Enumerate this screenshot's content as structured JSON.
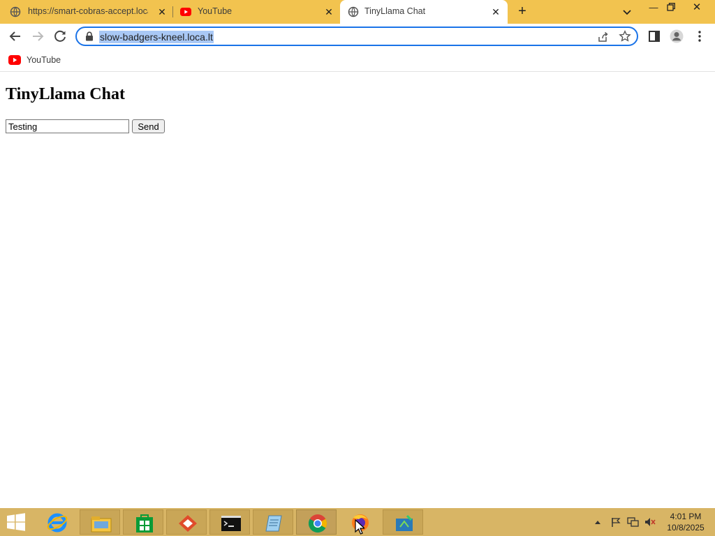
{
  "browser": {
    "tabs": [
      {
        "title": "https://smart-cobras-accept.loca.lt",
        "favicon": "globe-icon",
        "active": false
      },
      {
        "title": "YouTube",
        "favicon": "youtube-icon",
        "active": false
      },
      {
        "title": "TinyLlama Chat",
        "favicon": "globe-icon",
        "active": true
      }
    ],
    "address_bar": {
      "url": "slow-badgers-kneel.loca.lt",
      "selected": true
    },
    "bookmarks": [
      {
        "label": "YouTube",
        "icon": "youtube-icon"
      }
    ]
  },
  "page": {
    "heading": "TinyLlama Chat",
    "chat_input": {
      "value": "Testing"
    },
    "send_label": "Send"
  },
  "taskbar": {
    "apps": [
      "start-icon",
      "internet-explorer-icon",
      "file-explorer-icon",
      "store-icon",
      "app-icon",
      "command-prompt-icon",
      "notepad-icon",
      "chrome-icon",
      "firefox-icon",
      "media-icon"
    ],
    "clock": {
      "time": "4:01 PM",
      "date": "10/8/2025"
    }
  },
  "colors": {
    "titlebar": "#f2c34f",
    "taskbar": "#d8b565",
    "accent": "#1a73e8",
    "youtube": "#ff0000"
  }
}
